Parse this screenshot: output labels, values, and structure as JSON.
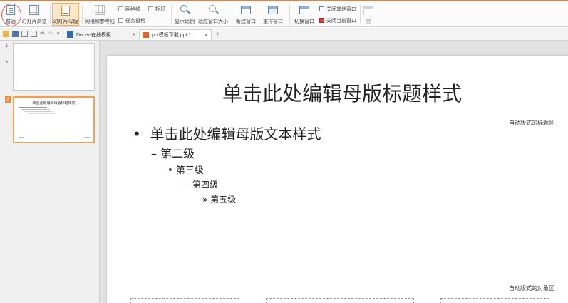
{
  "ribbon": {
    "normal_label": "普通",
    "slide_browse_label": "幻灯片浏览",
    "slide_master_label": "幻灯片母版",
    "grid_guides_label": "网格和参考线",
    "gridlines_label": "网格线",
    "ruler_label": "标尺",
    "taskpane_label": "任务窗格",
    "zoom_label": "显示比例",
    "fit_window_label": "适应窗口大小",
    "new_window_label": "新建窗口",
    "arrange_window_label": "重排窗口",
    "switch_window_label": "切换窗口",
    "close_others_label": "关闭其他窗口",
    "close_current_label": "关闭当前窗口",
    "macro_label": "宏"
  },
  "tabs": [
    {
      "label": "Docer-在线模板",
      "close": "×"
    },
    {
      "label": "ppt模板下载.ppt *",
      "close": "×"
    }
  ],
  "new_tab": "+",
  "thumbnails": [
    {
      "number": "1",
      "marker": "*"
    },
    {
      "number": "2",
      "title": "单击此处编辑母版标题样式"
    }
  ],
  "slide": {
    "title": "单击此处编辑母版标题样式",
    "title_area_label": "自动版式的标题区",
    "bullets": [
      "单击此处编辑母版文本样式",
      "第二级",
      "第三级",
      "第四级",
      "第五级"
    ],
    "bullet_marks": [
      "•",
      "–",
      "•",
      "–",
      "»"
    ],
    "object_area_label": "自动版式的对象区"
  },
  "colors": {
    "accent": "#e87e2f",
    "highlight_circle": "#e25b5b",
    "selected_thumb": "#f0a050"
  }
}
